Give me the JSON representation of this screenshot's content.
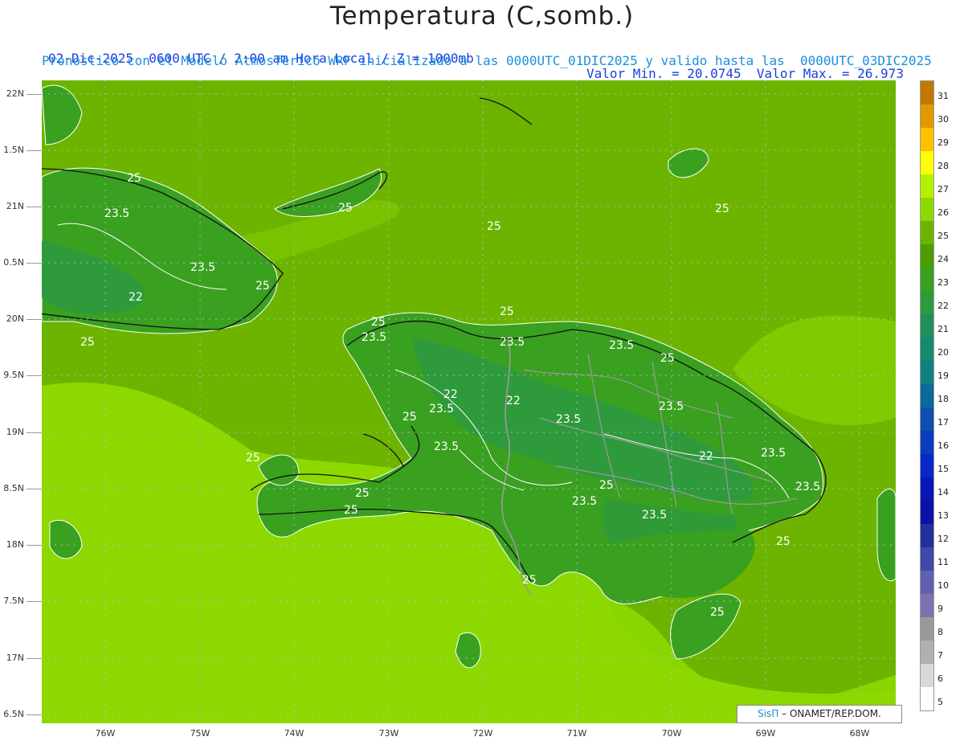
{
  "header": {
    "title": "Temperatura (C,somb.)",
    "line1_left": "02-Dic-2025  0600 UTC / 2:00 am Hora Local / Z = 1000mb",
    "line1_right": "Valor Min. = 20.0745  Valor Max. = 26.973",
    "line2": "Pronostico con el Modelo Atmosferico WRF inicializado a las 0000UTC_01DIC2025 y valido hasta las  0000UTC_03DIC2025"
  },
  "axes": {
    "y_labels": [
      "22N",
      "1.5N",
      "21N",
      "0.5N",
      "20N",
      "9.5N",
      "19N",
      "8.5N",
      "18N",
      "7.5N",
      "17N",
      "6.5N"
    ],
    "x_labels": [
      "76W",
      "75W",
      "74W",
      "73W",
      "72W",
      "71W",
      "70W",
      "69W",
      "68W"
    ]
  },
  "colorbar": {
    "labels": [
      "31",
      "30",
      "29",
      "28",
      "27",
      "26",
      "25",
      "24",
      "23",
      "22",
      "21",
      "20",
      "19",
      "18",
      "17",
      "16",
      "15",
      "14",
      "13",
      "12",
      "11",
      "10",
      "9",
      "8",
      "7",
      "6",
      "5"
    ],
    "colors": [
      "#c07800",
      "#e09a00",
      "#ffc000",
      "#ffff00",
      "#b4f000",
      "#8cd800",
      "#6cb400",
      "#4a9e00",
      "#3aa020",
      "#2e9a3c",
      "#20905a",
      "#158a6e",
      "#0d8080",
      "#0d6a98",
      "#0d50b0",
      "#0a3cc0",
      "#0828c8",
      "#0818b8",
      "#0a10a8",
      "#2030a0",
      "#4048a8",
      "#6060b0",
      "#8070b0",
      "#9a9a9a",
      "#b0b0b0",
      "#d8d8d8",
      "#ffffff"
    ]
  },
  "contour_labels": [
    "25",
    "23.5",
    "22",
    "23.5",
    "25",
    "25",
    "25",
    "25",
    "23.5",
    "22",
    "23.5",
    "25",
    "25",
    "25",
    "23.5",
    "25",
    "25",
    "23.5",
    "23.5",
    "22",
    "23.5",
    "23.5",
    "23.5",
    "23.5",
    "22",
    "23.5",
    "25",
    "25",
    "25",
    "23.5",
    "25",
    "25",
    "25",
    "25"
  ],
  "credit": {
    "brand": "SisΠ",
    "text": " – ONAMET/REP.DOM."
  },
  "colors": {
    "sea_light": "#8cd800",
    "sea_mid": "#6cb400",
    "land_warm": "#4a9e00",
    "land_cool": "#2e9a3c",
    "title_blue": "#1a40e0",
    "sub_blue": "#1a90e0"
  }
}
